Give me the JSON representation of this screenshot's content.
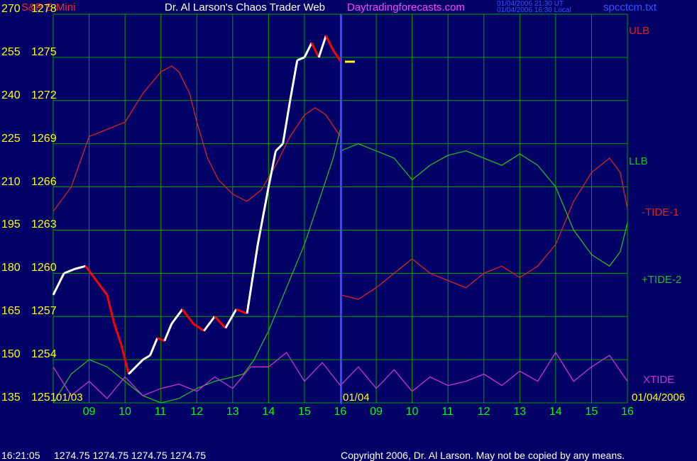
{
  "header": {
    "symbol": "S&P E-Mini",
    "title": "Dr. Al Larson's Chaos Trader Web",
    "site": "Daytradingforecasts.com",
    "time_utc": "01/04/2006 21:30 UT",
    "time_local": "01/04/2006 16:30 Local",
    "file": "spcctcm.txt"
  },
  "colors": {
    "background": "#000066",
    "grid": "#00a000",
    "axis_text": "#ffff00",
    "time_text": "#00ff00",
    "price": "#ffffff",
    "down_price": "#ff0000",
    "ulb": "#dd2222",
    "llb": "#22bb22",
    "tide1": "#dd2222",
    "tide2": "#22bb22",
    "xtide": "#cc33cc",
    "avg_blue": "#2233ff",
    "avg_yellow": "#dddd66"
  },
  "chart_data": {
    "type": "line",
    "title": "Dr. Al Larson's Chaos Trader Web",
    "left_axis_ticks": [
      "270",
      "255",
      "240",
      "225",
      "210",
      "195",
      "180",
      "165",
      "150",
      "135"
    ],
    "price_axis_ticks": [
      "1278",
      "1275",
      "1272",
      "1269",
      "1266",
      "1263",
      "1260",
      "1257",
      "1254",
      "1251"
    ],
    "ylim": [
      1251,
      1278
    ],
    "x_tick_labels": [
      "09",
      "10",
      "11",
      "12",
      "13",
      "14",
      "15",
      "16",
      "09",
      "10",
      "11",
      "12",
      "13",
      "14",
      "15",
      "16"
    ],
    "date_labels": [
      "01/03",
      "01/04",
      "01/04/2006"
    ],
    "xlim": [
      0,
      16
    ],
    "grid": true,
    "series": [
      {
        "name": "ULB",
        "color_key": "ulb",
        "x": [
          0,
          0.5,
          1,
          1.5,
          2,
          2.5,
          3,
          3.3,
          3.5,
          3.8,
          4,
          4.3,
          4.6,
          5,
          5.4,
          5.8,
          6.2,
          6.6,
          7,
          7.3,
          7.6,
          8
        ],
        "y": [
          1264.3,
          1266,
          1269.5,
          1270,
          1270.5,
          1272.5,
          1274,
          1274.4,
          1274,
          1272.5,
          1270.5,
          1268,
          1266.5,
          1265.5,
          1265,
          1265.8,
          1267.5,
          1269.5,
          1271,
          1271.5,
          1271,
          1269.5
        ]
      },
      {
        "name": "LLB",
        "color_key": "llb",
        "x": [
          0,
          0.5,
          1,
          1.5,
          2,
          2.5,
          3,
          3.5,
          4,
          4.5,
          5,
          5.3,
          5.6,
          6,
          6.5,
          7,
          7.4,
          7.8,
          8
        ],
        "y": [
          1251,
          1253,
          1254,
          1253.5,
          1252.5,
          1251.5,
          1251,
          1251.3,
          1252,
          1252.5,
          1252.8,
          1253,
          1254,
          1256,
          1259,
          1262,
          1265,
          1268,
          1270
        ]
      },
      {
        "name": "-TIDE-1",
        "color_key": "tide1",
        "x": [
          8,
          8.5,
          9,
          9.5,
          10,
          10.5,
          11,
          11.5,
          12,
          12.5,
          13,
          13.5,
          14,
          14.5,
          15,
          15.5,
          15.8,
          16
        ],
        "y": [
          1258.5,
          1258.2,
          1259,
          1260,
          1261,
          1260,
          1259.5,
          1259,
          1260,
          1260.5,
          1259.7,
          1260.5,
          1262,
          1265,
          1267,
          1268,
          1267,
          1264.5
        ]
      },
      {
        "name": "+TIDE-2",
        "color_key": "tide2",
        "x": [
          8,
          8.5,
          9,
          9.5,
          10,
          10.5,
          11,
          11.5,
          12,
          12.5,
          13,
          13.5,
          14,
          14.5,
          15,
          15.5,
          15.8,
          16
        ],
        "y": [
          1268.5,
          1269,
          1268.5,
          1268,
          1266.5,
          1267.5,
          1268.2,
          1268.5,
          1268,
          1267.5,
          1268.3,
          1267.5,
          1266,
          1263,
          1261.3,
          1260.5,
          1261.5,
          1263.5
        ]
      },
      {
        "name": "XTIDE",
        "color_key": "xtide",
        "x": [
          0,
          0.5,
          1,
          1.5,
          2,
          2.5,
          3,
          3.5,
          4,
          4.5,
          5,
          5.5,
          6,
          6.5,
          7,
          7.5,
          8,
          8.5,
          9,
          9.5,
          10,
          10.5,
          11,
          11.5,
          12,
          12.5,
          13,
          13.5,
          14,
          14.5,
          15,
          15.5,
          16
        ],
        "y": [
          1253.5,
          1251.5,
          1252.5,
          1251.3,
          1252.8,
          1251.5,
          1252,
          1252.3,
          1251.8,
          1252.8,
          1252,
          1253.5,
          1253.5,
          1254.5,
          1252.5,
          1253.8,
          1252.2,
          1253.5,
          1252,
          1253.3,
          1251.8,
          1252.8,
          1252.2,
          1252.5,
          1253,
          1252.2,
          1253.2,
          1252.5,
          1254.5,
          1252.5,
          1253.5,
          1254.3,
          1252.5
        ]
      }
    ],
    "price_series": {
      "name": "S&P E-Mini",
      "x": [
        0,
        0.3,
        0.6,
        0.9,
        1.2,
        1.5,
        1.7,
        1.9,
        2.1,
        2.3,
        2.5,
        2.7,
        2.9,
        3.1,
        3.3,
        3.6,
        3.9,
        4.2,
        4.5,
        4.8,
        5.1,
        5.4,
        5.7,
        6,
        6.2,
        6.4,
        6.6,
        6.8,
        7,
        7.2,
        7.4,
        7.6,
        7.8,
        8
      ],
      "y": [
        1258.5,
        1260,
        1260.3,
        1260.5,
        1259.5,
        1258.5,
        1256.5,
        1255,
        1253,
        1253.5,
        1254,
        1254.3,
        1255.5,
        1255.3,
        1256.5,
        1257.5,
        1256.5,
        1256,
        1257,
        1256.2,
        1257.5,
        1257.2,
        1262,
        1266,
        1268.5,
        1269,
        1272,
        1274.8,
        1275,
        1276,
        1275,
        1276.5,
        1275.5,
        1274.75
      ]
    },
    "last_price_marker": 1274.75,
    "right_labels": [
      "ULB",
      "LLB",
      "-TIDE-1",
      "+TIDE-2",
      "XTIDE"
    ]
  },
  "footer": {
    "time": "16:21:05",
    "quote": "1274.75 1274.75 1274.75 1274.75",
    "copyright": "Copyright 2006, Dr. Al Larson. May not be copied by any means."
  }
}
